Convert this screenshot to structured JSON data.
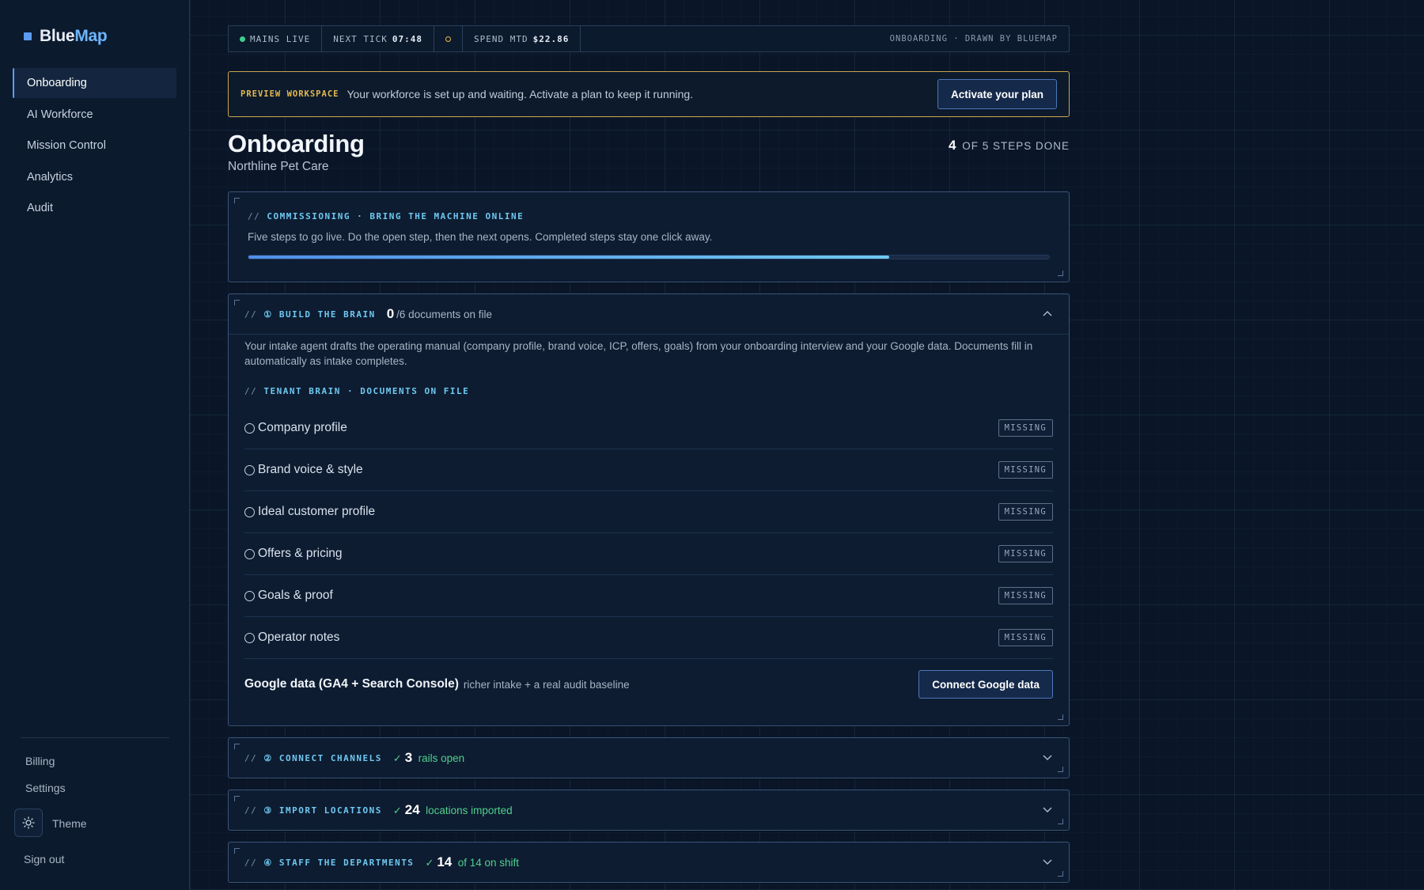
{
  "brand": {
    "name_a": "Blue",
    "name_b": "Map"
  },
  "nav": [
    {
      "label": "Onboarding",
      "active": true
    },
    {
      "label": "AI Workforce"
    },
    {
      "label": "Mission Control"
    },
    {
      "label": "Analytics"
    },
    {
      "label": "Audit"
    }
  ],
  "sidebar_bottom": {
    "billing": "Billing",
    "settings": "Settings",
    "theme": "Theme",
    "signout": "Sign out"
  },
  "statusbar": {
    "mains": "MAINS LIVE",
    "next_tick_label": "NEXT TICK",
    "next_tick_value": "07:48",
    "spend_label": "SPEND MTD",
    "spend_value": "$22.86",
    "right": "ONBOARDING · DRAWN BY BLUEMAP"
  },
  "banner": {
    "tag": "PREVIEW WORKSPACE",
    "text": "Your workforce is set up and waiting. Activate a plan to keep it running.",
    "button": "Activate your plan"
  },
  "page": {
    "title": "Onboarding",
    "subtitle": "Northline Pet Care",
    "steps_done_num": "4",
    "steps_done_text": "OF 5 STEPS DONE"
  },
  "commissioning": {
    "kicker": "COMMISSIONING · BRING THE MACHINE ONLINE",
    "desc": "Five steps to go live. Do the open step, then the next opens. Completed steps stay one click away.",
    "progress": 0.8
  },
  "step1": {
    "kicker": "① BUILD THE BRAIN",
    "count": "0",
    "count_rest": "/6 documents on file",
    "desc": "Your intake agent drafts the operating manual (company profile, brand voice, ICP, offers, goals) from your onboarding interview and your Google data. Documents fill in automatically as intake completes.",
    "docs_kicker": "TENANT BRAIN · DOCUMENTS ON FILE",
    "docs": [
      {
        "name": "Company profile",
        "status": "MISSING"
      },
      {
        "name": "Brand voice & style",
        "status": "MISSING"
      },
      {
        "name": "Ideal customer profile",
        "status": "MISSING"
      },
      {
        "name": "Offers & pricing",
        "status": "MISSING"
      },
      {
        "name": "Goals & proof",
        "status": "MISSING"
      },
      {
        "name": "Operator notes",
        "status": "MISSING"
      }
    ],
    "google_title": "Google data (GA4 + Search Console)",
    "google_sub": "richer intake + a real audit baseline",
    "google_button": "Connect Google data"
  },
  "step2": {
    "kicker": "② CONNECT CHANNELS",
    "count": "3",
    "count_rest": "rails open"
  },
  "step3": {
    "kicker": "③ IMPORT LOCATIONS",
    "count": "24",
    "count_rest": "locations imported"
  },
  "step4": {
    "kicker": "④ STAFF THE DEPARTMENTS",
    "count": "14",
    "count_rest": "of 14 on shift"
  },
  "symbols": {
    "slashes": "//",
    "check": "✓",
    "chev_up": "︿",
    "chev_down": "﹀"
  }
}
